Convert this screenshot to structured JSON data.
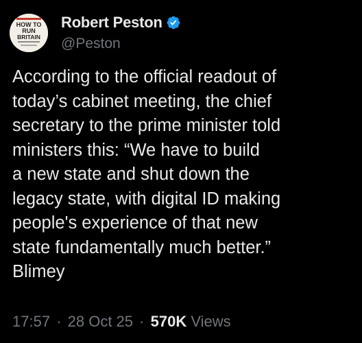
{
  "author": {
    "display_name": "Robert Peston",
    "handle": "@Peston",
    "verified": true,
    "avatar_text": [
      "HOW TO",
      "RUN",
      "BRITAIN"
    ]
  },
  "tweet": {
    "text": "According to the official readout of\ntoday’s cabinet meeting, the chief\nsecretary to the prime minister told\nministers this: “We have to build\na new state and shut down the\nlegacy state, with digital ID making\npeople's experience of that new\nstate fundamentally much better.”\nBlimey"
  },
  "meta": {
    "time": "17:57",
    "separator": "·",
    "date": "28 Oct 25",
    "views_count": "570K",
    "views_label": "Views"
  },
  "colors": {
    "background": "#000000",
    "text": "#e7e9ea",
    "secondary": "#71767b",
    "verified": "#1d9bf0"
  }
}
